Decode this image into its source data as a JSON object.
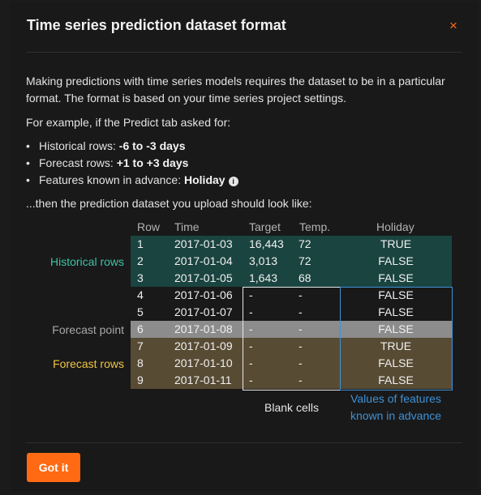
{
  "modal": {
    "title": "Time series prediction dataset format",
    "close_icon": "close-icon",
    "close_glyph": "×"
  },
  "intro": {
    "paragraph": "Making predictions with time series models requires the dataset to be in a particular format. The format is based on your time series project settings.",
    "example_lead": "For example, if the Predict tab asked for:",
    "bullets": [
      {
        "label": "Historical rows: ",
        "value": "-6 to -3 days"
      },
      {
        "label": "Forecast rows: ",
        "value": "+1 to +3 days"
      },
      {
        "label": "Features known in advance: ",
        "value": "Holiday"
      }
    ],
    "info_icon": "info-icon",
    "info_glyph": "i",
    "then_text": "...then the prediction dataset you upload should look like:"
  },
  "table": {
    "headers": [
      "Row",
      "Time",
      "Target",
      "Temp.",
      "Holiday"
    ],
    "rows": [
      {
        "row": "1",
        "time": "2017-01-03",
        "target": "16,443",
        "temp": "72",
        "holiday": "TRUE",
        "group": "historical"
      },
      {
        "row": "2",
        "time": "2017-01-04",
        "target": "3,013",
        "temp": "72",
        "holiday": "FALSE",
        "group": "historical"
      },
      {
        "row": "3",
        "time": "2017-01-05",
        "target": "1,643",
        "temp": "68",
        "holiday": "FALSE",
        "group": "historical"
      },
      {
        "row": "4",
        "time": "2017-01-06",
        "target": "-",
        "temp": "-",
        "holiday": "FALSE",
        "group": "gap"
      },
      {
        "row": "5",
        "time": "2017-01-07",
        "target": "-",
        "temp": "-",
        "holiday": "FALSE",
        "group": "gap"
      },
      {
        "row": "6",
        "time": "2017-01-08",
        "target": "-",
        "temp": "-",
        "holiday": "FALSE",
        "group": "forecast_point"
      },
      {
        "row": "7",
        "time": "2017-01-09",
        "target": "-",
        "temp": "-",
        "holiday": "TRUE",
        "group": "forecast"
      },
      {
        "row": "8",
        "time": "2017-01-10",
        "target": "-",
        "temp": "-",
        "holiday": "FALSE",
        "group": "forecast"
      },
      {
        "row": "9",
        "time": "2017-01-11",
        "target": "-",
        "temp": "-",
        "holiday": "FALSE",
        "group": "forecast"
      }
    ],
    "side_labels": {
      "historical": "Historical rows",
      "forecast_point": "Forecast point",
      "forecast": "Forecast rows"
    },
    "captions": {
      "blank": "Blank cells",
      "values_line1": "Values of features",
      "values_line2": "known in advance"
    },
    "colors": {
      "historical_bg": "#1a4440",
      "forecast_point_bg": "#8c8c8c",
      "forecast_bg": "#584b34",
      "historical_label": "#3dc4a6",
      "forecast_label": "#f0c444",
      "known_in_advance": "#3e91d6"
    }
  },
  "footer": {
    "button_label": "Got it",
    "accent": "#ff6a13"
  }
}
